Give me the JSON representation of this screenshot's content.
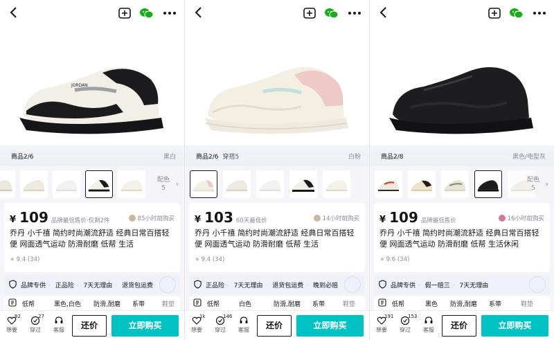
{
  "screens": [
    {
      "counter": "商品2/6",
      "counter_extra": "",
      "color_name": "黑白",
      "more_colors": "配色",
      "more_colors_count": "5",
      "price": "109",
      "price_note": "品牌最低售价·仅剩2件",
      "recent": "85小时前购买",
      "title": "乔丹 小千禧 简约时尚潮流舒适 经典日常百搭轻便 网面透气运动 防滑耐磨 低帮 生活",
      "rating": "9.4",
      "rating_count": "(34)",
      "services": [
        "品牌专供",
        "正品险",
        "7天无理由",
        "退货包运费"
      ],
      "params": [
        "低帮",
        "黑色,白色",
        "防滑,耐磨",
        "系带",
        "鞋垫"
      ],
      "actions": {
        "want_label": "想要",
        "want_count": "82",
        "worn_label": "穿过",
        "worn_count": "27",
        "service_label": "客服",
        "bargain": "还价",
        "buy": "立即购买"
      },
      "shoe_colors": {
        "upper": "#f1efe6",
        "accent": "#1b1b1d",
        "sole": "#161618",
        "trim": "#9ea0a4"
      }
    },
    {
      "counter": "商品2/6",
      "counter_extra": "穿搭5",
      "color_name": "白粉",
      "more_colors": "",
      "more_colors_count": "",
      "price": "103",
      "price_note": "60天最低价",
      "recent": "14小时前购买",
      "title": "乔丹 小千禧 简约时尚潮流舒适 经典日常百搭轻便 网面透气运动 防滑耐磨 低帮 生活",
      "rating": "9.4",
      "rating_count": "(34)",
      "services": [
        "正品险",
        "7天无理由",
        "退货包运费",
        "晚到必赔"
      ],
      "params": [
        "低帮",
        "白色",
        "防滑,耐磨",
        "系带",
        "鞋垫"
      ],
      "actions": {
        "want_label": "想要",
        "want_count": "1k",
        "worn_label": "穿过",
        "worn_count": "146",
        "service_label": "客服",
        "bargain": "还价",
        "buy": "立即购买"
      },
      "shoe_colors": {
        "upper": "#f4efe3",
        "accent": "#eec9c6",
        "sole": "#efeadf",
        "trim": "#bfe0df"
      }
    },
    {
      "counter": "商品2/8",
      "counter_extra": "",
      "color_name": "黑色/电型灰",
      "more_colors": "配色",
      "more_colors_count": "5",
      "price": "109",
      "price_note": "品牌最低售价",
      "recent": "16小时前购买",
      "title": "乔丹 小千禧 简约时尚潮流舒适 经典日常百搭轻便 网面透气运动 防滑耐磨 低帮 生活休闲",
      "rating": "9.6",
      "rating_count": "(34)",
      "services": [
        "品牌专供",
        "假一赔三",
        "7天无理由"
      ],
      "params": [
        "低帮",
        "黑色",
        "防滑,耐磨",
        "系带",
        "鞋垫"
      ],
      "actions": {
        "want_label": "想要",
        "want_count": "191",
        "worn_label": "穿过",
        "worn_count": "153",
        "service_label": "客服",
        "bargain": "还价",
        "buy": "立即购买"
      },
      "shoe_colors": {
        "upper": "#1d1d20",
        "accent": "#2a2a2e",
        "sole": "#121214",
        "trim": "#3a3a3f"
      }
    }
  ],
  "top_icons": [
    "back-icon",
    "sell-icon",
    "wechat-icon",
    "more-icon"
  ],
  "brand_color": "#01c2c3"
}
